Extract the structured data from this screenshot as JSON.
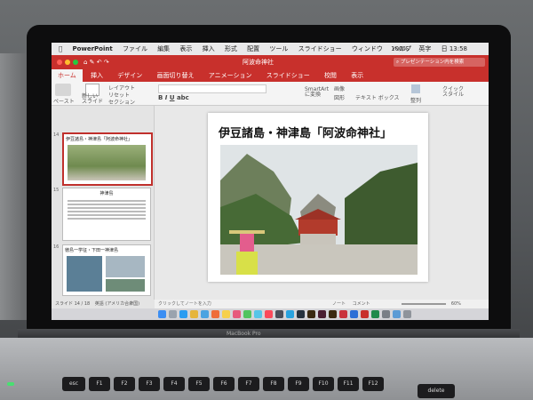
{
  "menubar": {
    "app_name": "PowerPoint",
    "items": [
      "ファイル",
      "編集",
      "表示",
      "挿入",
      "形式",
      "配置",
      "ツール",
      "スライドショー",
      "ウィンドウ",
      "ヘルプ"
    ],
    "battery": "100%",
    "input_source": "英字",
    "clock": "日 13:58"
  },
  "window": {
    "title": "阿波命神社",
    "search_hint": "プレゼンテーション内を検索"
  },
  "tabs": [
    "ホーム",
    "挿入",
    "デザイン",
    "画面切り替え",
    "アニメーション",
    "スライドショー",
    "校閲",
    "表示"
  ],
  "ribbon": {
    "paste": "ペースト",
    "new_slide": "新しい\nスライド",
    "layout": "レイアウト",
    "reset": "リセット",
    "section": "セクション",
    "convert": "SmartArt\nに変換",
    "picture": "画像",
    "shape": "図形",
    "text_box": "テキスト ボックス",
    "arrange": "整列",
    "quick_style": "クイック\nスタイル"
  },
  "slides_pane": {
    "slides": [
      {
        "num": "14",
        "title": "伊豆諸島・神津島「阿波命神社」",
        "selected": true
      },
      {
        "num": "15",
        "title": "神津島",
        "selected": false
      },
      {
        "num": "16",
        "title": "徳島一学征・下田一神津島",
        "selected": false
      }
    ]
  },
  "main_slide": {
    "title": "伊豆諸島・神津島「阿波命神社」"
  },
  "notes": {
    "placeholder": "クリックしてノートを入力"
  },
  "status": {
    "slide_count": "スライド 14 / 18",
    "language": "英語 (アメリカ合衆国)",
    "notes_btn": "ノート",
    "comments_btn": "コメント",
    "zoom": "60%"
  },
  "colors": {
    "accent": "#c8302c",
    "led": "#48e070"
  },
  "keyboard": {
    "keys": [
      "esc",
      "F1",
      "F2",
      "F3",
      "F4",
      "F5",
      "F6",
      "F7",
      "F8",
      "F9",
      "F10",
      "F11",
      "F12"
    ],
    "right_label": "delete"
  },
  "laptop_label": "MacBook Pro"
}
